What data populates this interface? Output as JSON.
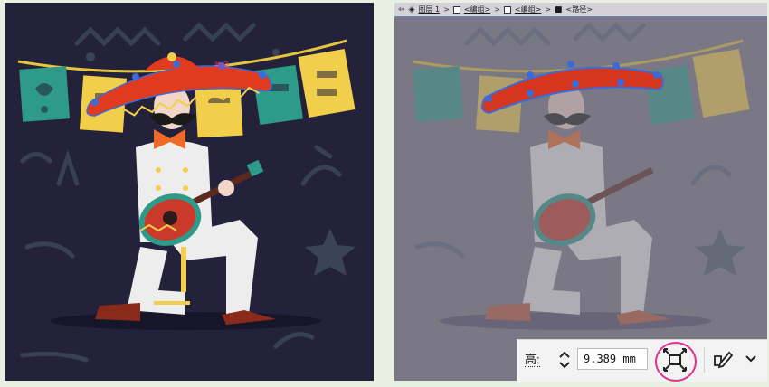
{
  "breadcrumb": {
    "items": [
      "图层 1",
      "<编组>",
      "<编组>",
      "<路径>"
    ],
    "separator": ">"
  },
  "canvas": {
    "anchor_label": "路径"
  },
  "toolbar": {
    "height_label": "高:",
    "height_value": "9.389 mm"
  },
  "icons": [
    "back-arrow-icon",
    "layers-icon",
    "group-icon",
    "path-icon",
    "stepper-up-icon",
    "stepper-down-icon",
    "fit-to-artboard-icon",
    "edit-shape-icon",
    "chevron-down-icon"
  ],
  "colors": {
    "accent": "#e0328f",
    "selection": "#3d6bd6",
    "sombrero": "#e03a1f",
    "flag_teal": "#2e9a8a",
    "flag_yellow": "#f2cf4a"
  }
}
